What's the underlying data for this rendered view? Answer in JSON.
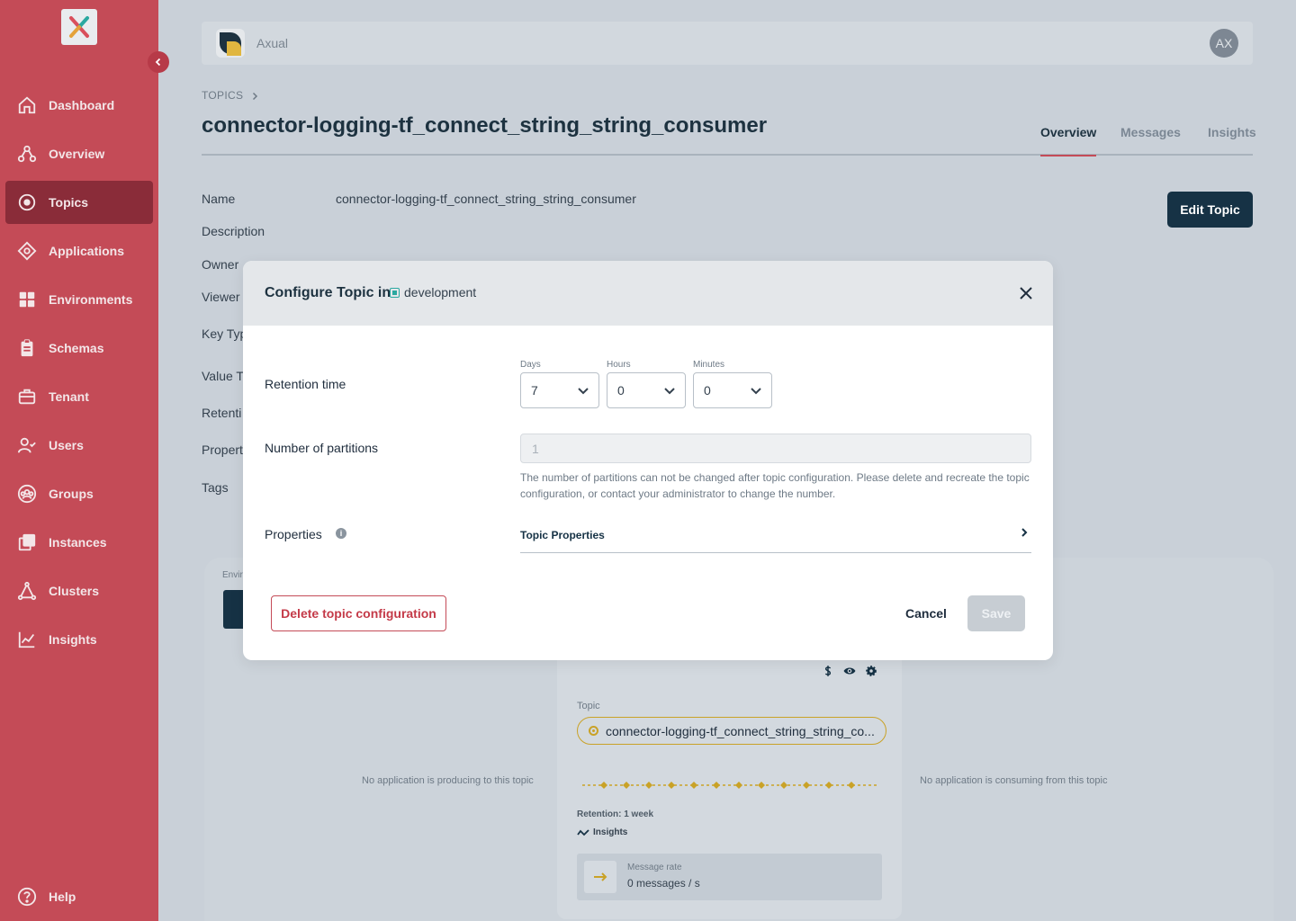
{
  "sidebar": {
    "items": [
      {
        "label": "Dashboard",
        "icon": "home-icon"
      },
      {
        "label": "Overview",
        "icon": "overview-icon"
      },
      {
        "label": "Topics",
        "icon": "topic-icon",
        "active": true
      },
      {
        "label": "Applications",
        "icon": "application-icon"
      },
      {
        "label": "Environments",
        "icon": "grid-icon"
      },
      {
        "label": "Schemas",
        "icon": "clipboard-icon"
      },
      {
        "label": "Tenant",
        "icon": "briefcase-icon"
      },
      {
        "label": "Users",
        "icon": "users-icon"
      },
      {
        "label": "Groups",
        "icon": "groups-icon"
      },
      {
        "label": "Instances",
        "icon": "instances-icon"
      },
      {
        "label": "Clusters",
        "icon": "cluster-icon"
      },
      {
        "label": "Insights",
        "icon": "insights-icon"
      }
    ],
    "help_label": "Help"
  },
  "header": {
    "org_name": "Axual",
    "avatar_initials": "AX"
  },
  "breadcrumb": {
    "root": "TOPICS"
  },
  "page": {
    "title": "connector-logging-tf_connect_string_string_consumer",
    "tabs": [
      {
        "label": "Overview",
        "active": true
      },
      {
        "label": "Messages"
      },
      {
        "label": "Insights"
      }
    ],
    "edit_button": "Edit Topic"
  },
  "details": {
    "name_label": "Name",
    "name_value": "connector-logging-tf_connect_string_string_consumer",
    "description_label": "Description",
    "owner_label": "Owner",
    "viewer_label": "Viewer",
    "key_type_label": "Key Typ",
    "value_type_label": "Value T",
    "retention_label": "Retenti",
    "properties_label": "Propert",
    "tags_label": "Tags"
  },
  "graph": {
    "env_label": "Envir",
    "topic_label": "Topic",
    "topic_name": "connector-logging-tf_connect_string_string_co...",
    "no_producer": "No application is producing to this topic",
    "no_consumer": "No application is consuming from this topic",
    "retention": "Retention: 1 week",
    "insights_link": "Insights",
    "message_rate_label": "Message rate",
    "message_rate_value": "0 messages / s"
  },
  "modal": {
    "title": "Configure Topic in",
    "environment": "development",
    "retention_label": "Retention time",
    "days_label": "Days",
    "days_value": "7",
    "hours_label": "Hours",
    "hours_value": "0",
    "minutes_label": "Minutes",
    "minutes_value": "0",
    "partitions_label": "Number of partitions",
    "partitions_value": "1",
    "partitions_helper": "The number of partitions can not be changed after topic configuration. Please delete and recreate the topic configuration, or contact your administrator to change the number.",
    "properties_label": "Properties",
    "topic_properties": "Topic Properties",
    "delete_button": "Delete topic configuration",
    "cancel_button": "Cancel",
    "save_button": "Save"
  },
  "colors": {
    "sidebar": "#c44b57",
    "sidebar_active": "#8a2c39",
    "primary": "#163245",
    "accent": "#c44b57",
    "topic_gold": "#c9a227",
    "env_teal": "#2aa8a0"
  }
}
